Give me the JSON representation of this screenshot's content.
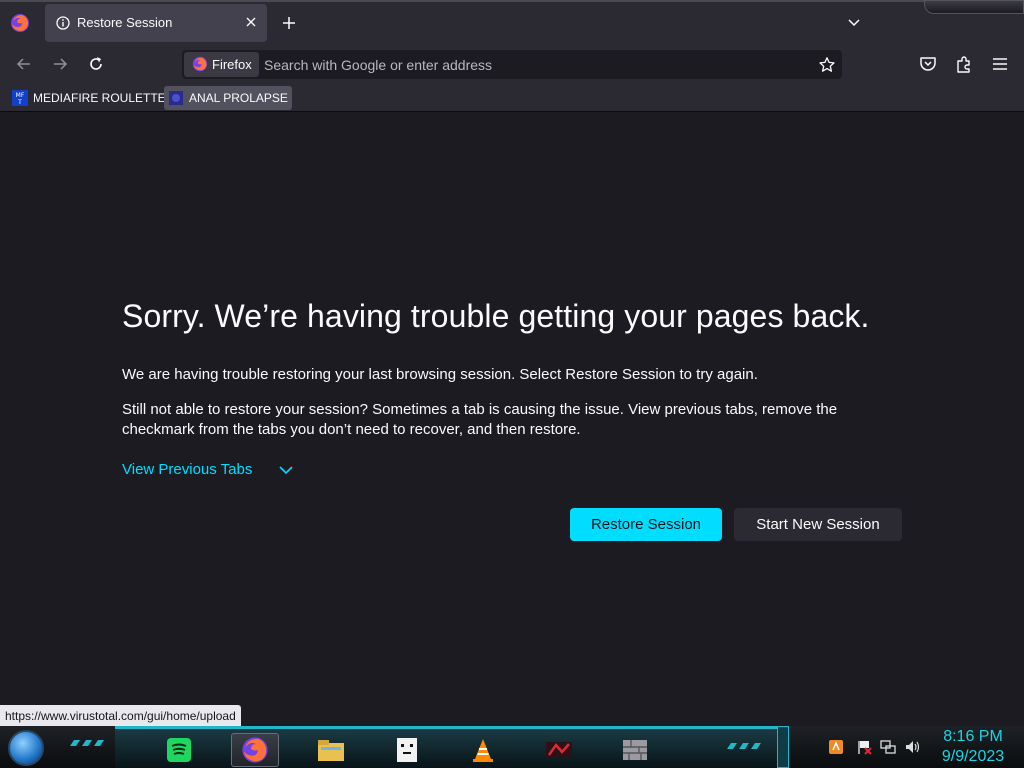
{
  "tab": {
    "title": "Restore Session"
  },
  "urlbar": {
    "identity_label": "Firefox",
    "placeholder": "Search with Google or enter address"
  },
  "bookmarks": [
    {
      "label": "MEDIAFIRE ROULETTER",
      "icon": "mft-favicon"
    },
    {
      "label": "ANAL PROLAPSE",
      "icon": "blue-favicon"
    }
  ],
  "page": {
    "title": "Sorry. We’re having trouble getting your pages back.",
    "p1": "We are having trouble restoring your last browsing session. Select Restore Session to try again.",
    "p2": "Still not able to restore your session? Sometimes a tab is causing the issue. View previous tabs, remove the checkmark from the tabs you don’t need to recover, and then restore.",
    "view_previous_tabs": "View Previous Tabs",
    "restore_button": "Restore Session",
    "new_session_button": "Start New Session"
  },
  "status_link": "https://www.virustotal.com/gui/home/upload",
  "taskbar": {
    "apps": [
      "spotify",
      "firefox",
      "file-explorer",
      "game-app",
      "vlc",
      "media-app",
      "stone-app"
    ],
    "tray_icons": [
      "app-tray-icon",
      "flag-icon",
      "network-icon",
      "volume-icon"
    ],
    "time": "8:16 PM",
    "date": "9/9/2023"
  },
  "colors": {
    "accent": "#00ddff",
    "toolbar": "#2b2a33",
    "background": "#1c1b22",
    "taskbar_accent": "#1fb7c9"
  }
}
